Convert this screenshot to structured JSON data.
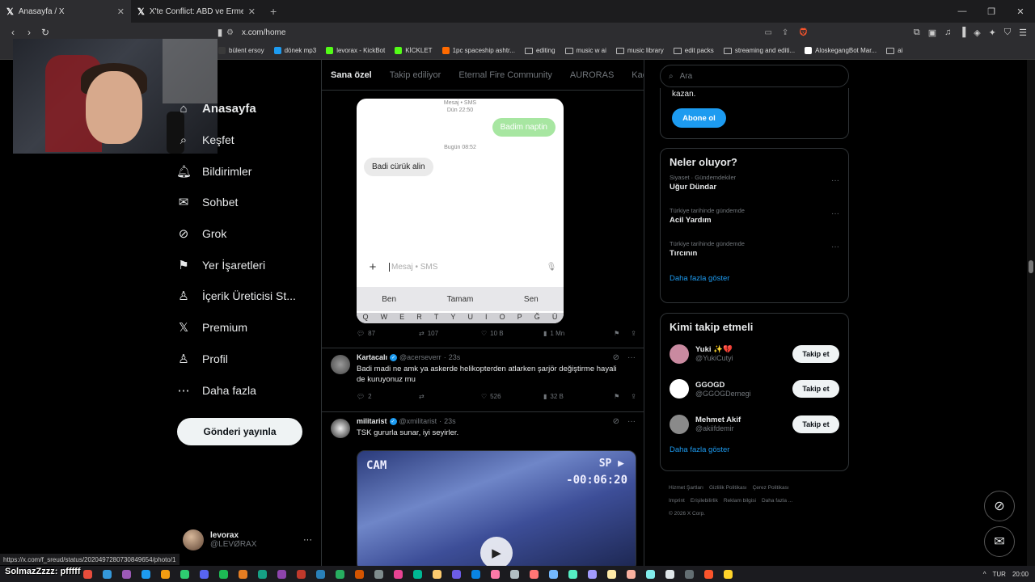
{
  "browser": {
    "tabs": [
      {
        "title": "Anasayfa / X",
        "active": true
      },
      {
        "title": "X'te Conflict: ABD ve Ermenistan",
        "active": false
      }
    ],
    "url": "x.com/home",
    "status_url": "https://x.com/f_sreud/status/2020497280730849654/photo/1",
    "bookmarks": [
      {
        "label": "bülent ersoy",
        "icon": "music-icon",
        "color": "#3a3a3a"
      },
      {
        "label": "dönek mp3",
        "icon": "page-icon",
        "color": "#1d9bf0"
      },
      {
        "label": "levorax - KickBot",
        "icon": "kick-icon",
        "color": "#53fc18"
      },
      {
        "label": "KİCKLET",
        "icon": "kick-icon",
        "color": "#53fc18"
      },
      {
        "label": "1pc spaceship ashtr...",
        "icon": "shop-icon",
        "color": "#ff6a00"
      },
      {
        "label": "editing",
        "icon": "folder-icon",
        "color": ""
      },
      {
        "label": "music w ai",
        "icon": "folder-icon",
        "color": ""
      },
      {
        "label": "music library",
        "icon": "folder-icon",
        "color": ""
      },
      {
        "label": "edit packs",
        "icon": "folder-icon",
        "color": ""
      },
      {
        "label": "streaming and editi...",
        "icon": "folder-icon",
        "color": ""
      },
      {
        "label": "AloskegangBot Mar...",
        "icon": "github-icon",
        "color": "#ffffff"
      },
      {
        "label": "ai",
        "icon": "folder-icon",
        "color": ""
      }
    ]
  },
  "nav": {
    "items": [
      {
        "label": "Anasayfa",
        "icon": "home-icon",
        "glyph": "⌂"
      },
      {
        "label": "Keşfet",
        "icon": "search-icon",
        "glyph": "⌕"
      },
      {
        "label": "Bildirimler",
        "icon": "bell-icon",
        "glyph": "🔔︎"
      },
      {
        "label": "Sohbet",
        "icon": "mail-icon",
        "glyph": "✉"
      },
      {
        "label": "Grok",
        "icon": "grok-icon",
        "glyph": "⊘"
      },
      {
        "label": "Yer İşaretleri",
        "icon": "bookmark-icon",
        "glyph": "⚑"
      },
      {
        "label": "İçerik Üreticisi St...",
        "icon": "creator-icon",
        "glyph": "♙"
      },
      {
        "label": "Premium",
        "icon": "x-logo-icon",
        "glyph": "𝕏"
      },
      {
        "label": "Profil",
        "icon": "person-icon",
        "glyph": "♙"
      },
      {
        "label": "Daha fazla",
        "icon": "more-circle-icon",
        "glyph": "⋯"
      }
    ],
    "post_button": "Gönderi yayınla",
    "account": {
      "name": "levorax",
      "handle": "@LEVØRAX"
    }
  },
  "feed": {
    "tabs": [
      "Sana özel",
      "Takip ediliyor",
      "Eternal Fire Community",
      "AURORAS",
      "Kachow"
    ],
    "phone": {
      "meta_top": "Mesaj • SMS",
      "meta_top_time": "Dün 22:50",
      "outgoing": "Badim naptin",
      "meta_mid": "Bugün 08:52",
      "incoming": "Badi cürük alin",
      "composer_placeholder": "Mesaj • SMS",
      "suggestions": [
        "Ben",
        "Tamam",
        "Sen"
      ],
      "keys": [
        "Q",
        "W",
        "E",
        "R",
        "T",
        "Y",
        "U",
        "I",
        "O",
        "P",
        "Ğ",
        "Ü"
      ]
    },
    "tweet1_stats": {
      "replies": "87",
      "reposts": "107",
      "likes": "10 B",
      "views": "1 Mn"
    },
    "tweets": [
      {
        "name": "Kartacalı",
        "handle": "@acerseverr",
        "time": "23s",
        "text": "Badi madi ne amk ya askerde helikopterden atlarken şarjör değiştirme hayali de kuruyonuz mu",
        "replies": "2",
        "reposts": "",
        "likes": "526",
        "views": "32 B"
      },
      {
        "name": "militarist",
        "handle": "@xmilitarist",
        "time": "23s",
        "text": "TSK gururla sunar, iyi seyirler.",
        "video": {
          "cam": "CAM",
          "sp": "SP",
          "timecode": "-00:06:20"
        }
      }
    ]
  },
  "sidebar": {
    "search_placeholder": "Ara",
    "subscribe": {
      "text": "kazan.",
      "button": "Abone ol"
    },
    "trends_title": "Neler oluyor?",
    "trends": [
      {
        "context": "Siyaset · Gündemdekiler",
        "title": "Uğur Dündar"
      },
      {
        "context": "Türkiye tarihinde gündemde",
        "title": "Acil Yardım"
      },
      {
        "context": "Türkiye tarihinde gündemde",
        "title": "Tırcının"
      }
    ],
    "show_more": "Daha fazla göster",
    "who_title": "Kimi takip etmeli",
    "who": [
      {
        "name": "Yuki ✨💔",
        "handle": "@YukiCutyi",
        "button": "Takip et",
        "color": "#c98aa0"
      },
      {
        "name": "GGOGD",
        "handle": "@GGOGDernegi",
        "button": "Takip et",
        "color": "#ffffff"
      },
      {
        "name": "Mehmet Akif",
        "handle": "@akiifdemir",
        "button": "Takip et",
        "color": "#8a8a8a"
      }
    ],
    "footer": [
      "Hizmet Şartları",
      "Gizlilik Politikası",
      "Çerez Politikası",
      "Imprint",
      "Erişilebilirlik",
      "Reklam bilgisi",
      "Daha fazla ...",
      "© 2026 X Corp."
    ]
  },
  "stream_overlay": "SolmazZzzz: pfffff",
  "taskbar": {
    "lang": "TUR",
    "time": "20:00"
  }
}
